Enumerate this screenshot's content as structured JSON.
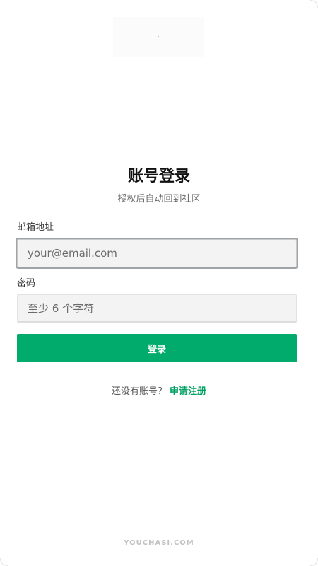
{
  "header": {
    "title": "账号登录",
    "subtitle": "授权后自动回到社区"
  },
  "form": {
    "email_label": "邮箱地址",
    "email_placeholder": "your@email.com",
    "email_value": "",
    "password_label": "密码",
    "password_placeholder": "至少 6 个字符",
    "password_value": "",
    "submit_label": "登录"
  },
  "signup": {
    "prompt": "还没有账号？",
    "link_label": "申请注册"
  },
  "footer": {
    "brand": "YOUCHASI.COM"
  },
  "colors": {
    "primary": "#00ab6b",
    "link": "#00a060",
    "input_bg": "#f3f3f3",
    "title": "#111111"
  },
  "icons": {
    "logo": "logo-placeholder"
  }
}
